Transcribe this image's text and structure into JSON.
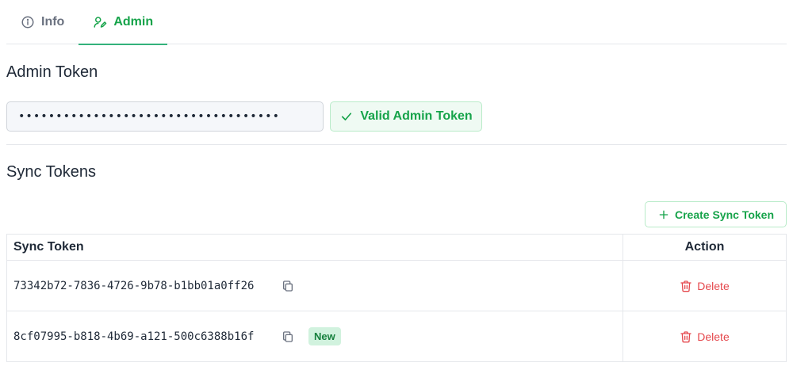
{
  "tabs": [
    {
      "label": "Info",
      "icon": "info-circle-icon",
      "active": false
    },
    {
      "label": "Admin",
      "icon": "user-edit-icon",
      "active": true
    }
  ],
  "admin": {
    "heading": "Admin Token",
    "token_value": "•••••••••••••••••••••••••••••••••••",
    "valid_label": "Valid Admin Token"
  },
  "sync": {
    "heading": "Sync Tokens",
    "create_label": "Create Sync Token",
    "columns": [
      "Sync Token",
      "Action"
    ],
    "rows": [
      {
        "token": "73342b72-7836-4726-9b78-b1bb01a0ff26",
        "badge": "",
        "action": "Delete"
      },
      {
        "token": "8cf07995-b818-4b69-a121-500c6388b16f",
        "badge": "New",
        "action": "Delete"
      }
    ]
  },
  "colors": {
    "accent": "#16a34a",
    "danger": "#e5484d",
    "badge_bg": "#d1f2de"
  }
}
